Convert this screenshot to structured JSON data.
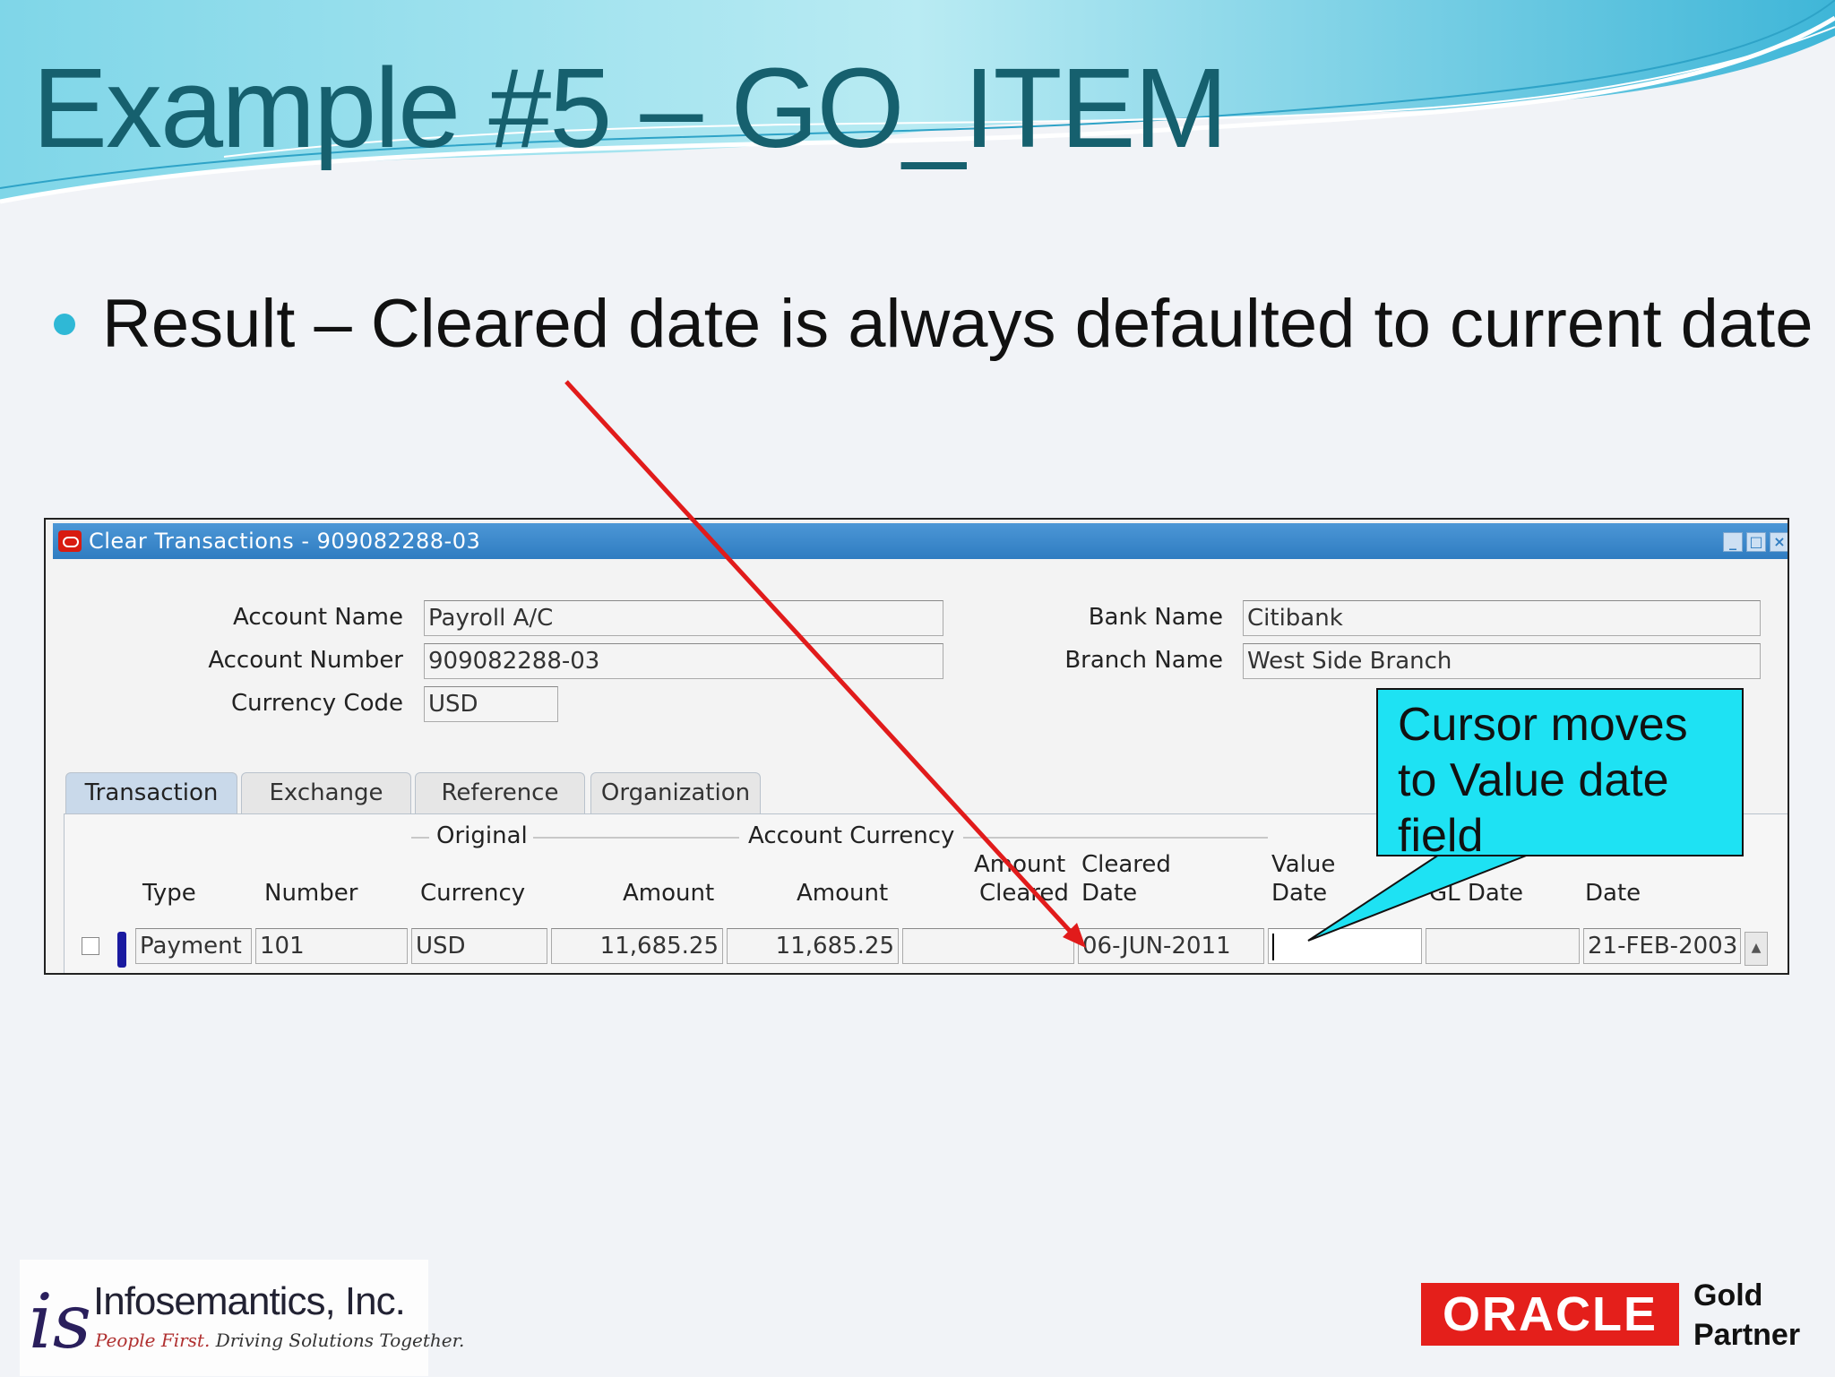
{
  "slide": {
    "title": "Example #5 – GO_ITEM",
    "bullet": "Result – Cleared date is always defaulted to current date"
  },
  "window": {
    "title": "Clear Transactions - 909082288-03",
    "header": {
      "account_name_label": "Account Name",
      "account_name": "Payroll A/C",
      "account_number_label": "Account Number",
      "account_number": "909082288-03",
      "currency_code_label": "Currency Code",
      "currency_code": "USD",
      "bank_name_label": "Bank Name",
      "bank_name": "Citibank",
      "branch_name_label": "Branch Name",
      "branch_name": "West Side Branch"
    },
    "tabs": [
      {
        "label": "Transaction"
      },
      {
        "label": "Exchange"
      },
      {
        "label": "Reference"
      },
      {
        "label": "Organization"
      }
    ],
    "groups": {
      "original": "Original",
      "account_currency": "Account Currency"
    },
    "columns": {
      "type": "Type",
      "number": "Number",
      "currency": "Currency",
      "amount": "Amount",
      "acct_amount": "Amount",
      "amount_cleared_1": "Amount",
      "amount_cleared_2": "Cleared",
      "cleared_date_1": "Cleared",
      "cleared_date_2": "Date",
      "value_date_1": "Value",
      "value_date_2": "Date",
      "gl_date": "GL Date",
      "date": "Date"
    },
    "row": {
      "type": "Payment",
      "number": "101",
      "currency": "USD",
      "amount": "11,685.25",
      "acct_amount": "11,685.25",
      "amount_cleared": "",
      "cleared_date": "06-JUN-2011",
      "value_date": "",
      "gl_date": "",
      "date": "21-FEB-2003"
    }
  },
  "callout": {
    "text": "Cursor moves to Value date field"
  },
  "logos": {
    "infosemantics_name": "Infosemantics, Inc.",
    "infosemantics_tag_a": "People First.",
    "infosemantics_tag_b": "Driving Solutions Together.",
    "oracle": "ORACLE",
    "partner_1": "Gold",
    "partner_2": "Partner"
  },
  "colors": {
    "title": "#16606e",
    "window_title_bar": "#2f7cc1",
    "callout": "#1ee2f3",
    "arrow": "#e11b1b",
    "oracle": "#e41f1b"
  }
}
